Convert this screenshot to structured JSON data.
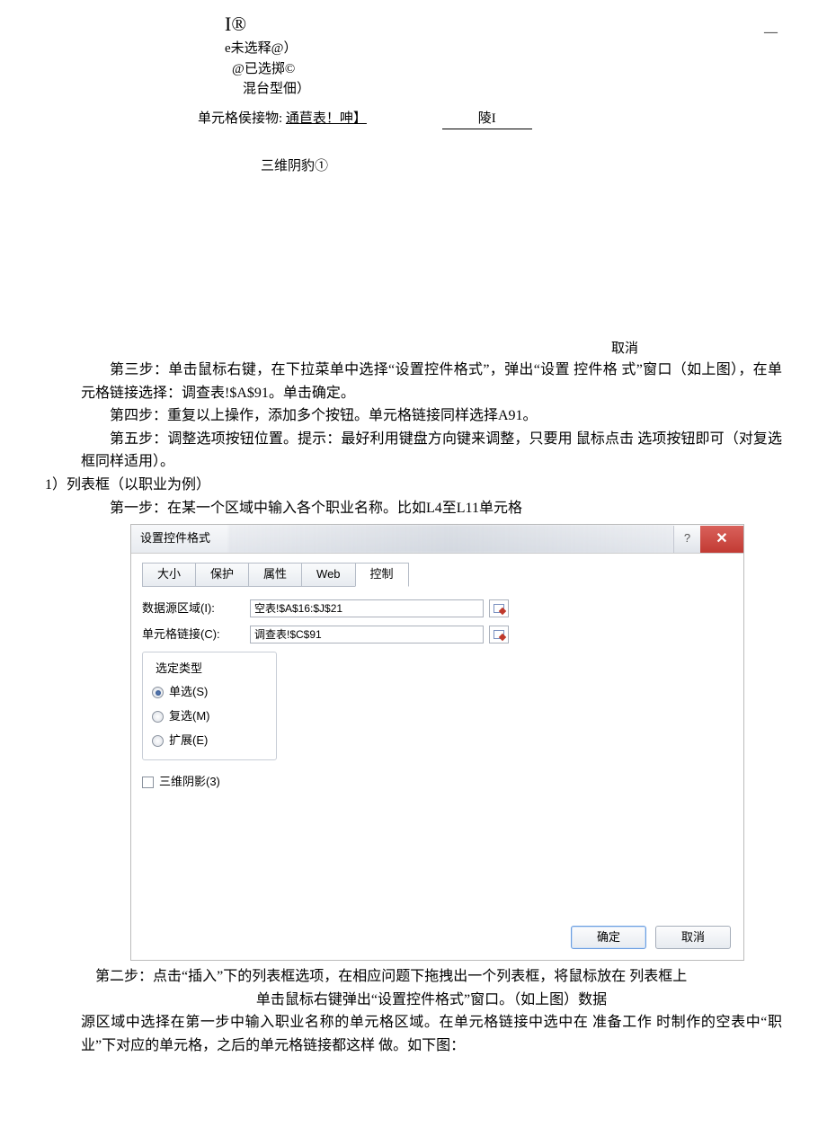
{
  "top": {
    "ir": "I®",
    "dash": "—",
    "bullet1": "e未选释@）",
    "bullet2": "@已选掷©",
    "bullet3": "混台型佃）",
    "linkLabel": "单元格侯接物:",
    "linkUnderline": "通苣表！呻】",
    "ling": "陵I",
    "shadow3d": "三维阴豹①",
    "cancel": "取消"
  },
  "paragraphs": {
    "p3": "第三步：单击鼠标右键，在下拉菜单中选择“设置控件格式”，弹出“设置 控件格 式”窗口（如上图），在单元格链接选择：调查表!$A$91。单击确定。",
    "p4": "第四步：重复以上操作，添加多个按钮。单元格链接同样选择A91。",
    "p5": "第五步：调整选项按钮位置。提示：最好利用键盘方向键来调整，只要用 鼠标点击 选项按钮即可（对复选框同样适用）。",
    "listHeader": "1）列表框（以职业为例）",
    "p1": "第一步：在某一个区域中输入各个职业名称。比如L4至L11单元格",
    "p2a": "第二步：点击“插入”下的列表框选项，在相应问题下拖拽出一个列表框，将鼠标放在 列表框上",
    "p2b": "单击鼠标右键弹出“设置控件格式”窗口。（如上图）数据",
    "p2c": "源区域中选择在第一步中输入职业名称的单元格区域。在单元格链接中选中在 准备工作 时制作的空表中“职业”下对应的单元格，之后的单元格链接都这样 做。如下图："
  },
  "dialog": {
    "title": "设置控件格式",
    "tabs": {
      "size": "大小",
      "protect": "保护",
      "attr": "属性",
      "web": "Web",
      "control": "控制"
    },
    "labels": {
      "sourceRange": "数据源区域(I):",
      "cellLink": "单元格链接(C):",
      "selectType": "选定类型",
      "single": "单选(S)",
      "multi": "复选(M)",
      "extend": "扩展(E)",
      "shadow": "三维阴影(3)"
    },
    "values": {
      "sourceRange": "空表!$A$16:$J$21",
      "cellLink": "调查表!$C$91"
    },
    "buttons": {
      "ok": "确定",
      "cancel": "取消"
    }
  }
}
